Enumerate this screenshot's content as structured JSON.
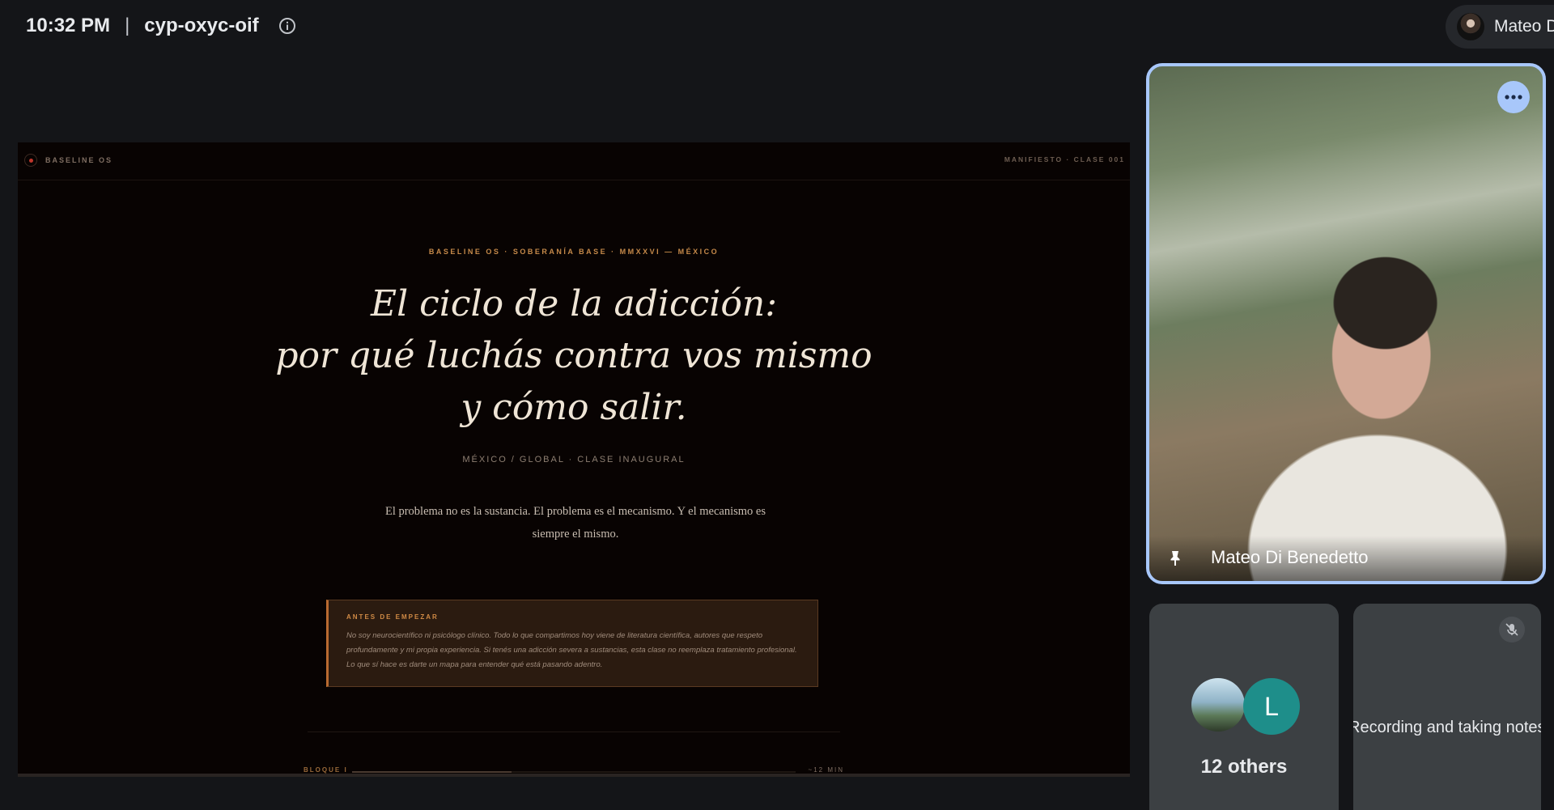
{
  "meeting": {
    "time": "10:32 PM",
    "separator": "|",
    "code": "cyp-oxyc-oif",
    "self_name": "Mateo D",
    "self_name_visible": "Mateo D"
  },
  "slide": {
    "brand": "BASELINE OS",
    "meta": "MANIFIESTO · CLASE 001",
    "eyebrow": "BASELINE OS · SOBERANÍA BASE · MMXXVI — MÉXICO",
    "headline_line1": "El ciclo de la adicción:",
    "headline_line2": "por qué luchás contra vos mismo",
    "headline_line3": "y cómo salir.",
    "tagline": "MÉXICO / GLOBAL · CLASE INAUGURAL",
    "lead": "El problema no es la sustancia. El problema es el mecanismo. Y el mecanismo es siempre el mismo.",
    "notice_title": "ANTES DE EMPEZAR",
    "notice_body": "No soy neurocientífico ni psicólogo clínico. Todo lo que compartimos hoy viene de literatura científica, autores que respeto profundamente y mi propia experiencia. Si tenés una adicción severa a sustancias, esta clase no reemplaza tratamiento profesional. Lo que sí hace es darte un mapa para entender qué está pasando adentro.",
    "block_label": "BLOQUE I",
    "block_time": "~12 MIN",
    "block_progress": 0.36
  },
  "participants": {
    "speaker_name": "Mateo Di Benedetto",
    "others_initial": "L",
    "others_count": "12 others",
    "notes_label": "Recording and taking notes"
  },
  "icons": {
    "info": "info-icon",
    "more": "more-options-icon",
    "pin": "pin-icon",
    "mic_off": "mic-off-icon"
  },
  "colors": {
    "accent_border": "#a8c7fa",
    "avatar_teal": "#1e8e8a",
    "slide_accent": "#c68a4a"
  }
}
